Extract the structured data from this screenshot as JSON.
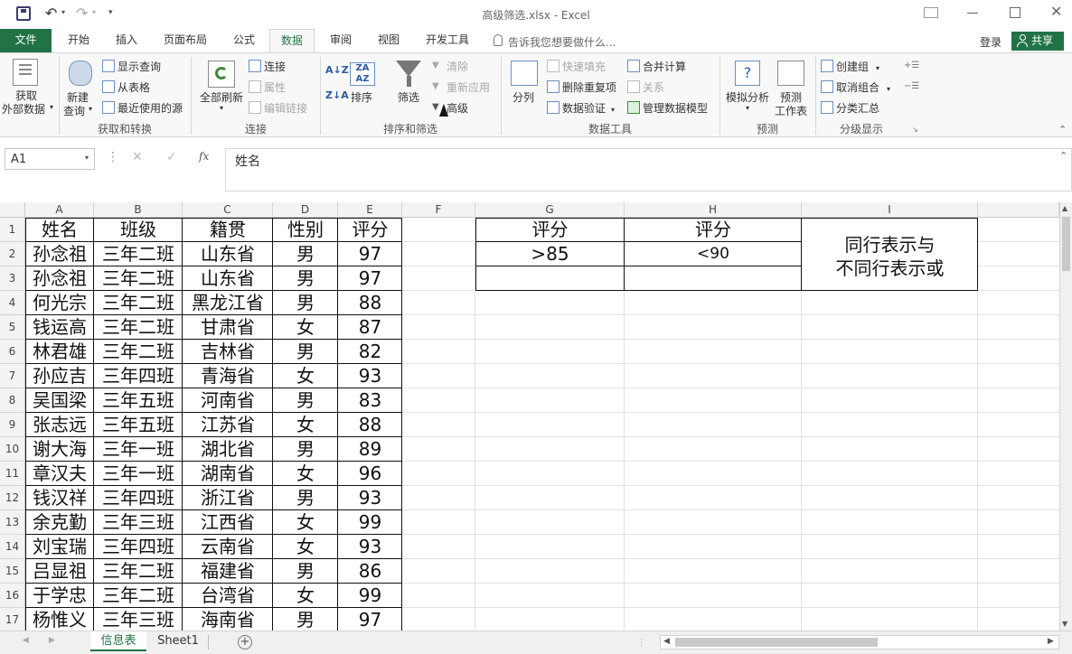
{
  "titlebar": {
    "title": "高级筛选.xlsx - Excel"
  },
  "tabs": {
    "file": "文件",
    "home": "开始",
    "insert": "插入",
    "layout": "页面布局",
    "formulas": "公式",
    "data": "数据",
    "review": "审阅",
    "view": "视图",
    "developer": "开发工具",
    "tell": "告诉我您想要做什么...",
    "login": "登录",
    "share": "共享"
  },
  "ribbon": {
    "get_external": "获取",
    "get_external2": "外部数据",
    "new_query": "新建",
    "new_query2": "查询",
    "show_query": "显示查询",
    "from_table": "从表格",
    "recent_sources": "最近使用的源",
    "group_get": "获取和转换",
    "refresh_all": "全部刷新",
    "connections": "连接",
    "properties": "属性",
    "edit_links": "编辑链接",
    "group_conn": "连接",
    "sort": "排序",
    "filter": "筛选",
    "clear": "清除",
    "reapply": "重新应用",
    "advanced": "高级",
    "group_sort": "排序和筛选",
    "split": "分列",
    "flash_fill": "快速填充",
    "remove_dup": "删除重复项",
    "validation": "数据验证",
    "consolidate": "合并计算",
    "relations": "关系",
    "data_model": "管理数据模型",
    "group_tools": "数据工具",
    "what_if": "模拟分析",
    "forecast": "预测",
    "forecast2": "工作表",
    "group_forecast": "预测",
    "group": "创建组",
    "ungroup": "取消组合",
    "subtotal": "分类汇总",
    "group_outline": "分级显示"
  },
  "formula": {
    "namebox": "A1",
    "fx": "fx",
    "content": "姓名"
  },
  "columns": [
    "A",
    "B",
    "C",
    "D",
    "E",
    "F",
    "G",
    "H",
    "I"
  ],
  "rows": [
    "1",
    "2",
    "3",
    "4",
    "5",
    "6",
    "7",
    "8",
    "9",
    "10",
    "11",
    "12",
    "13",
    "14",
    "15",
    "16",
    "17"
  ],
  "table": {
    "header": [
      "姓名",
      "班级",
      "籍贯",
      "性别",
      "评分"
    ],
    "data": [
      [
        "孙念祖",
        "三年二班",
        "山东省",
        "男",
        "97"
      ],
      [
        "孙念祖",
        "三年二班",
        "山东省",
        "男",
        "97"
      ],
      [
        "何光宗",
        "三年二班",
        "黑龙江省",
        "男",
        "88"
      ],
      [
        "钱运高",
        "三年二班",
        "甘肃省",
        "女",
        "87"
      ],
      [
        "林君雄",
        "三年二班",
        "吉林省",
        "男",
        "82"
      ],
      [
        "孙应吉",
        "三年四班",
        "青海省",
        "女",
        "93"
      ],
      [
        "吴国梁",
        "三年五班",
        "河南省",
        "男",
        "83"
      ],
      [
        "张志远",
        "三年五班",
        "江苏省",
        "女",
        "88"
      ],
      [
        "谢大海",
        "三年一班",
        "湖北省",
        "男",
        "89"
      ],
      [
        "章汉夫",
        "三年一班",
        "湖南省",
        "女",
        "96"
      ],
      [
        "钱汉祥",
        "三年四班",
        "浙江省",
        "男",
        "93"
      ],
      [
        "余克勤",
        "三年三班",
        "江西省",
        "女",
        "99"
      ],
      [
        "刘宝瑞",
        "三年四班",
        "云南省",
        "女",
        "93"
      ],
      [
        "吕显祖",
        "三年二班",
        "福建省",
        "男",
        "86"
      ],
      [
        "于学忠",
        "三年二班",
        "台湾省",
        "女",
        "99"
      ],
      [
        "杨惟义",
        "三年三班",
        "海南省",
        "男",
        "97"
      ]
    ]
  },
  "criteria": {
    "g1": "评分",
    "h1": "评分",
    "g2": ">85",
    "h2": "<90",
    "note1": "同行表示与",
    "note2": "不同行表示或"
  },
  "sheets": {
    "active": "信息表",
    "other": "Sheet1"
  }
}
